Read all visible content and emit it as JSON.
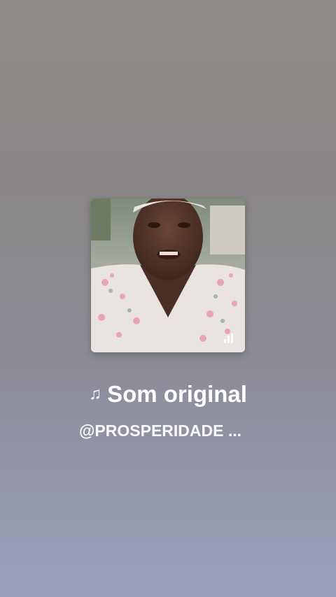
{
  "audio": {
    "title": "Som original",
    "author": "@PROSPERIDADE ...",
    "note_icon": "♫",
    "cover_icon": "audio-cover-thumbnail",
    "playing_indicator_icon": "equalizer-bars-icon"
  },
  "colors": {
    "background_top": "#8f8a86",
    "background_bottom": "#9aa0bc",
    "text": "#ffffff"
  }
}
